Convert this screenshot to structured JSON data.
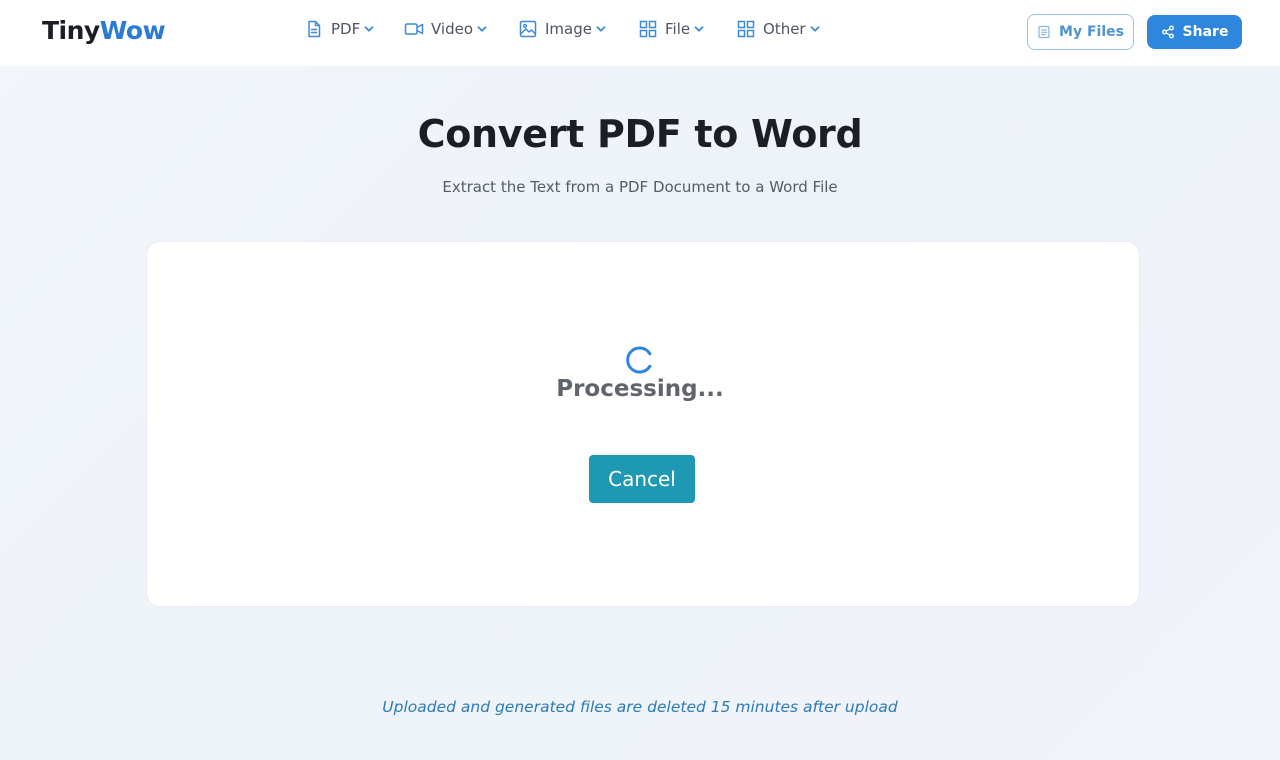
{
  "brand": {
    "part1": "Tiny",
    "part2": "Wow",
    "accent": "#2b7bd3"
  },
  "nav": [
    {
      "label": "PDF",
      "icon": "pdf-file-icon"
    },
    {
      "label": "Video",
      "icon": "video-camera-icon"
    },
    {
      "label": "Image",
      "icon": "image-icon"
    },
    {
      "label": "File",
      "icon": "grid-icon"
    },
    {
      "label": "Other",
      "icon": "grid-icon"
    }
  ],
  "header": {
    "my_files_label": "My Files",
    "share_label": "Share"
  },
  "page": {
    "title": "Convert PDF to Word",
    "subtitle": "Extract the Text from a PDF Document to a Word File"
  },
  "status": {
    "text": "Processing...",
    "cancel_label": "Cancel"
  },
  "footer": {
    "note": "Uploaded and generated files are deleted 15 minutes after upload"
  },
  "colors": {
    "primary": "#2f86dd",
    "cancel": "#1f98b3",
    "note": "#2d7bb6"
  }
}
